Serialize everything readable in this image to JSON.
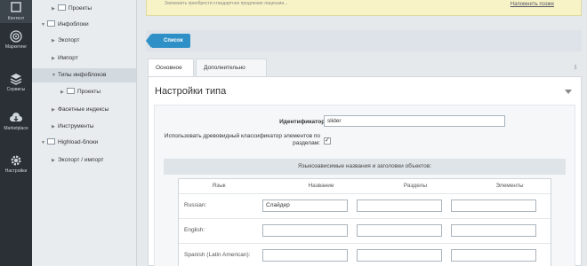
{
  "rail": {
    "items": [
      {
        "label": "Контент",
        "icon": "content-icon"
      },
      {
        "label": "Маркетинг",
        "icon": "target-icon"
      },
      {
        "label": "Сервисы",
        "icon": "layers-icon"
      },
      {
        "label": "Marketplace",
        "icon": "cloud-icon"
      },
      {
        "label": "Настройки",
        "icon": "gear-icon"
      }
    ]
  },
  "tree": {
    "items": [
      {
        "label": "Проекты"
      },
      {
        "label": "Инфоблоки"
      },
      {
        "label": "Экспорт"
      },
      {
        "label": "Импорт"
      },
      {
        "label": "Типы инфоблоков"
      },
      {
        "label": "Проекты"
      },
      {
        "label": "Фасетные индексы"
      },
      {
        "label": "Инструменты"
      },
      {
        "label": "Highload-блоки"
      },
      {
        "label": "Экспорт / импорт"
      }
    ]
  },
  "notice": {
    "text": "Запомнить приобрести стандартное продление лицензии...",
    "link": "Напомнить позже"
  },
  "toolbar": {
    "list_label": "Список"
  },
  "tabs": [
    {
      "label": "Основное"
    },
    {
      "label": "Дополнительно"
    }
  ],
  "panel": {
    "title": "Настройки типа",
    "id_label": "Идентификатор (ID):",
    "id_value": "slider",
    "tree_classifier_label": "Использовать древовидный классификатор элементов по разделам:",
    "section_title": "Языкозависимые названия и заголовки объектов:"
  },
  "grid": {
    "headers": [
      "Язык",
      "Название",
      "Разделы",
      "Элементы"
    ],
    "rows": [
      {
        "lang": "Russian:",
        "name": "Слайдер",
        "sections": "",
        "elements": ""
      },
      {
        "lang": "English:",
        "name": "",
        "sections": "",
        "elements": ""
      },
      {
        "lang": "Spanish (Latin American):",
        "name": "",
        "sections": "",
        "elements": ""
      }
    ]
  },
  "colors": {
    "accent": "#2f90c7",
    "rail": "#2a3036",
    "notice": "#f7f3c6"
  }
}
